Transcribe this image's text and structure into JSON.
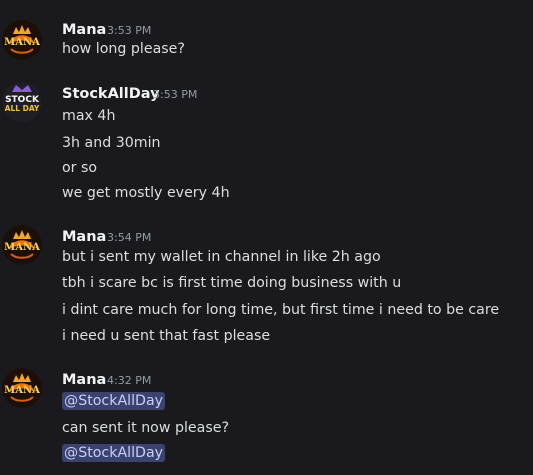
{
  "messages": [
    {
      "author": "Mana",
      "time": "3:53 PM",
      "avatar_icon": "mana-logo-avatar",
      "lines": [
        "how long please?"
      ]
    },
    {
      "author": "StockAllDay",
      "time": "3:53 PM",
      "avatar_icon": "stockallday-logo-avatar",
      "avatar_text": [
        "STOCK",
        "ALL DAY"
      ],
      "lines": [
        "max 4h",
        "3h and 30min",
        "or so",
        "we get mostly every 4h"
      ]
    },
    {
      "author": "Mana",
      "time": "3:54 PM",
      "avatar_icon": "mana-logo-avatar",
      "lines": [
        "but i sent my wallet in channel in like 2h ago",
        "tbh i scare bc is first time doing business with u",
        "i dint care much for long time, but first time i need to be care",
        "i need u sent that fast please"
      ]
    },
    {
      "author": "Mana",
      "time": "4:32 PM",
      "avatar_icon": "mana-logo-avatar",
      "lines": [
        "@StockAllDay",
        "can sent it now please?",
        "@StockAllDay"
      ]
    }
  ],
  "colors": {
    "background": "#1a1a1e",
    "text": "#dbdee1",
    "username": "#f2f3f5",
    "timestamp": "#949ba4",
    "mention_bg": "#3c4270",
    "mention_text": "#c9cdfb"
  }
}
